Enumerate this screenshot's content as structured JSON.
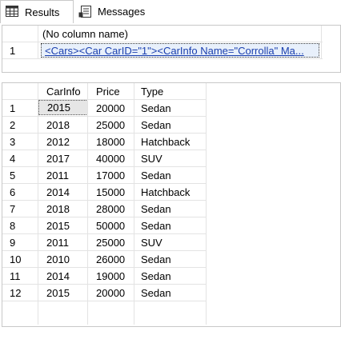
{
  "tabs": [
    {
      "label": "Results",
      "active": true,
      "icon": "results-grid-icon"
    },
    {
      "label": "Messages",
      "active": false,
      "icon": "messages-icon"
    }
  ],
  "result1": {
    "column_header": "(No column name)",
    "rows": [
      {
        "num": "1",
        "value": "<Cars><Car CarID=\"1\"><CarInfo Name=\"Corrolla\" Ma..."
      }
    ]
  },
  "result2": {
    "columns": [
      "CarInfo",
      "Price",
      "Type"
    ],
    "rows": [
      {
        "num": "1",
        "carinfo": "2015",
        "price": "20000",
        "type": "Sedan"
      },
      {
        "num": "2",
        "carinfo": "2018",
        "price": "25000",
        "type": "Sedan"
      },
      {
        "num": "3",
        "carinfo": "2012",
        "price": "18000",
        "type": "Hatchback"
      },
      {
        "num": "4",
        "carinfo": "2017",
        "price": "40000",
        "type": "SUV"
      },
      {
        "num": "5",
        "carinfo": "2011",
        "price": "17000",
        "type": "Sedan"
      },
      {
        "num": "6",
        "carinfo": "2014",
        "price": "15000",
        "type": "Hatchback"
      },
      {
        "num": "7",
        "carinfo": "2018",
        "price": "28000",
        "type": "Sedan"
      },
      {
        "num": "8",
        "carinfo": "2015",
        "price": "50000",
        "type": "Sedan"
      },
      {
        "num": "9",
        "carinfo": "2011",
        "price": "25000",
        "type": "SUV"
      },
      {
        "num": "10",
        "carinfo": "2010",
        "price": "26000",
        "type": "Sedan"
      },
      {
        "num": "11",
        "carinfo": "2014",
        "price": "19000",
        "type": "Sedan"
      },
      {
        "num": "12",
        "carinfo": "2015",
        "price": "20000",
        "type": "Sedan"
      }
    ]
  },
  "colors": {
    "grid_line": "#e3e3e3",
    "pane_border": "#c8c8c8",
    "link": "#1a3fae",
    "selected_cell": "#e6e6e6"
  }
}
